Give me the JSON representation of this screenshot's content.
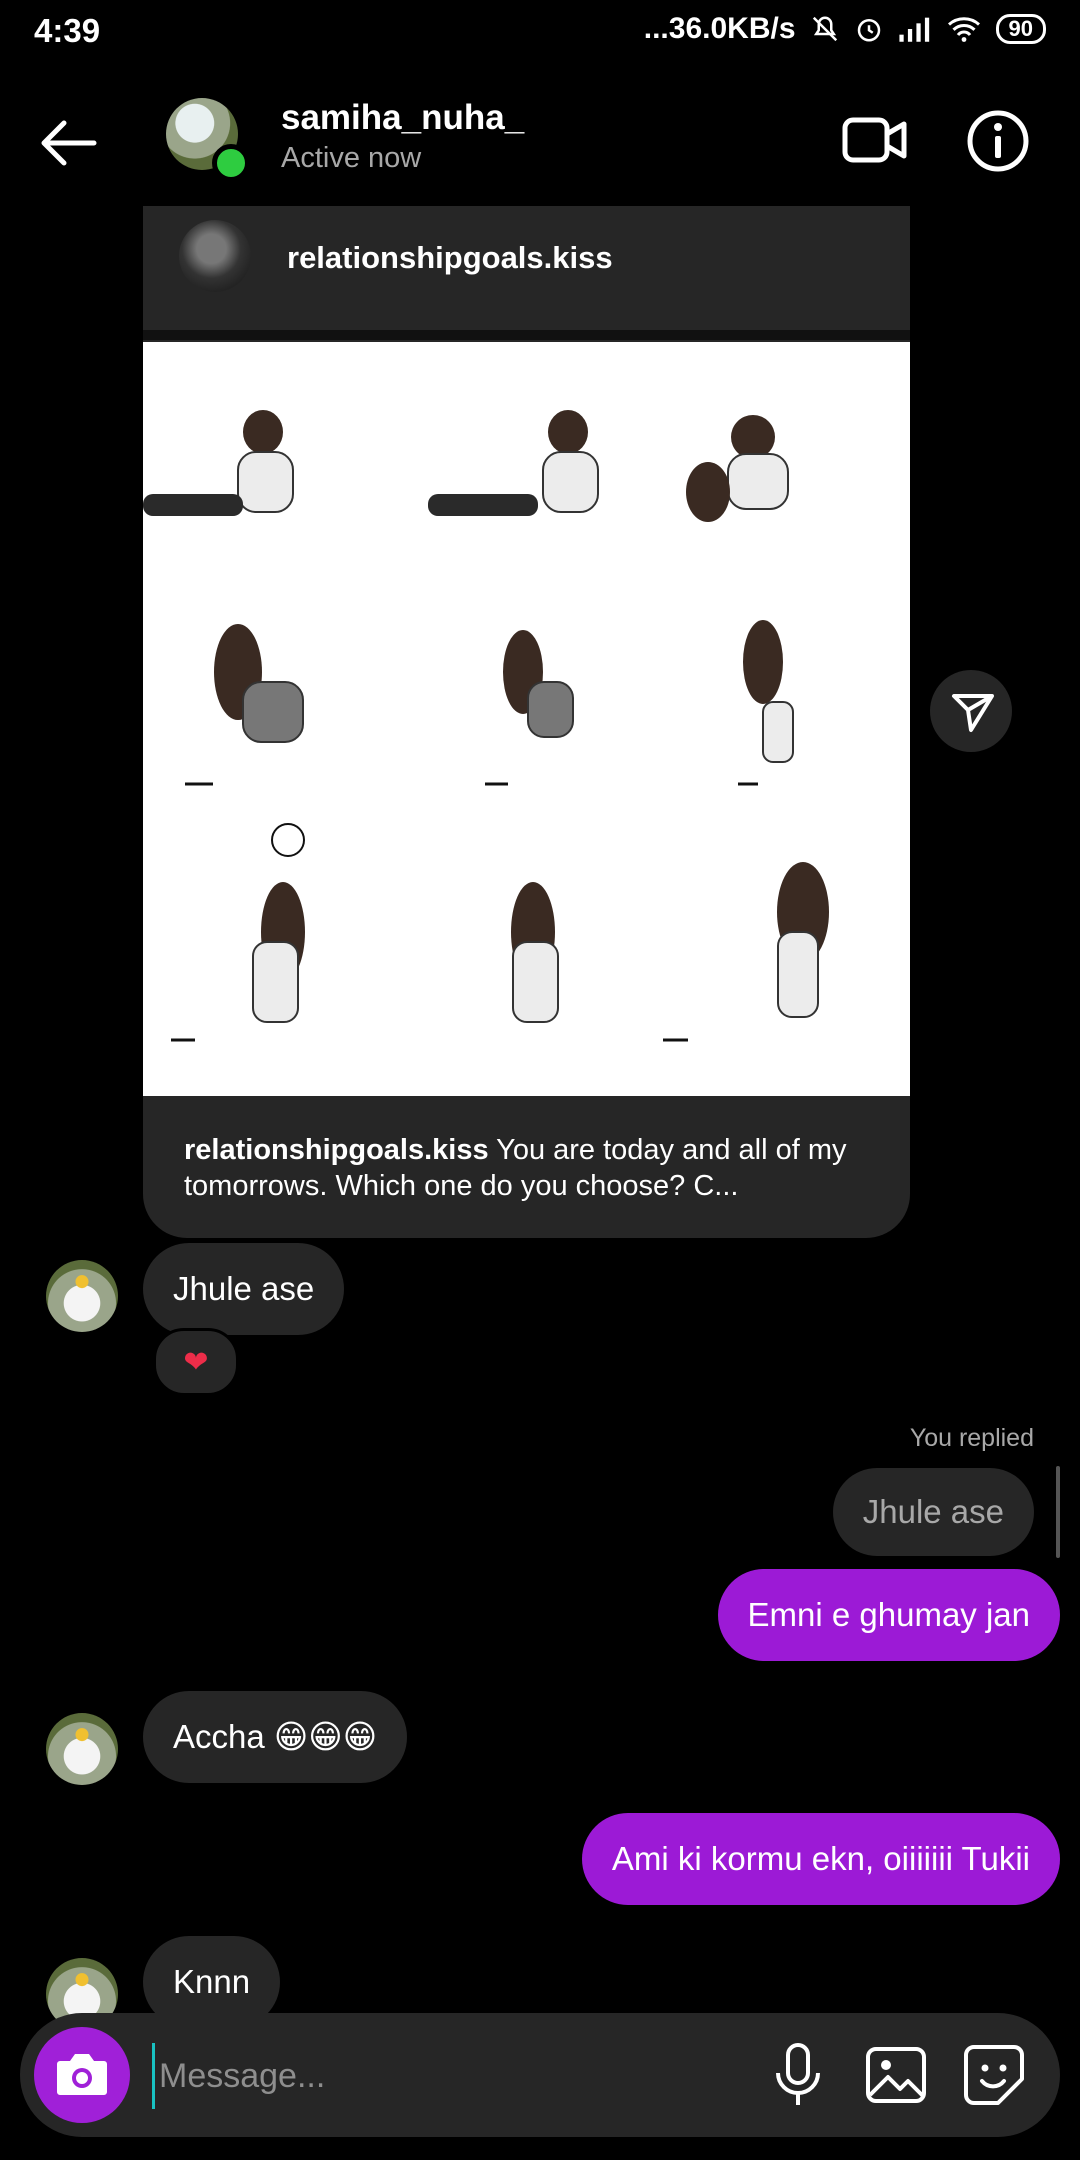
{
  "status_bar": {
    "time": "4:39",
    "network": "...36.0KB/s",
    "battery": "90"
  },
  "header": {
    "name": "samiha_nuha_",
    "status": "Active now"
  },
  "shared_post": {
    "author": "relationshipgoals.kiss",
    "caption_author": "relationshipgoals.kiss",
    "caption_text": " You are today and all of my tomorrows. Which one do you choose? C..."
  },
  "messages": {
    "m1": "Jhule ase",
    "reaction": "❤",
    "you_replied_label": "You replied",
    "reply_quote": "Jhule ase",
    "m2": "Emni e ghumay jan",
    "m3": "Accha 😁😁😁",
    "m4": "Ami ki kormu ekn, oiiiiiii Tukii",
    "m5": "Knnn"
  },
  "composer": {
    "placeholder": "Message..."
  },
  "colors": {
    "outgoing": "#9c1ad6",
    "incoming": "#262626",
    "camera": "#a020d8",
    "online": "#2ecc40"
  }
}
